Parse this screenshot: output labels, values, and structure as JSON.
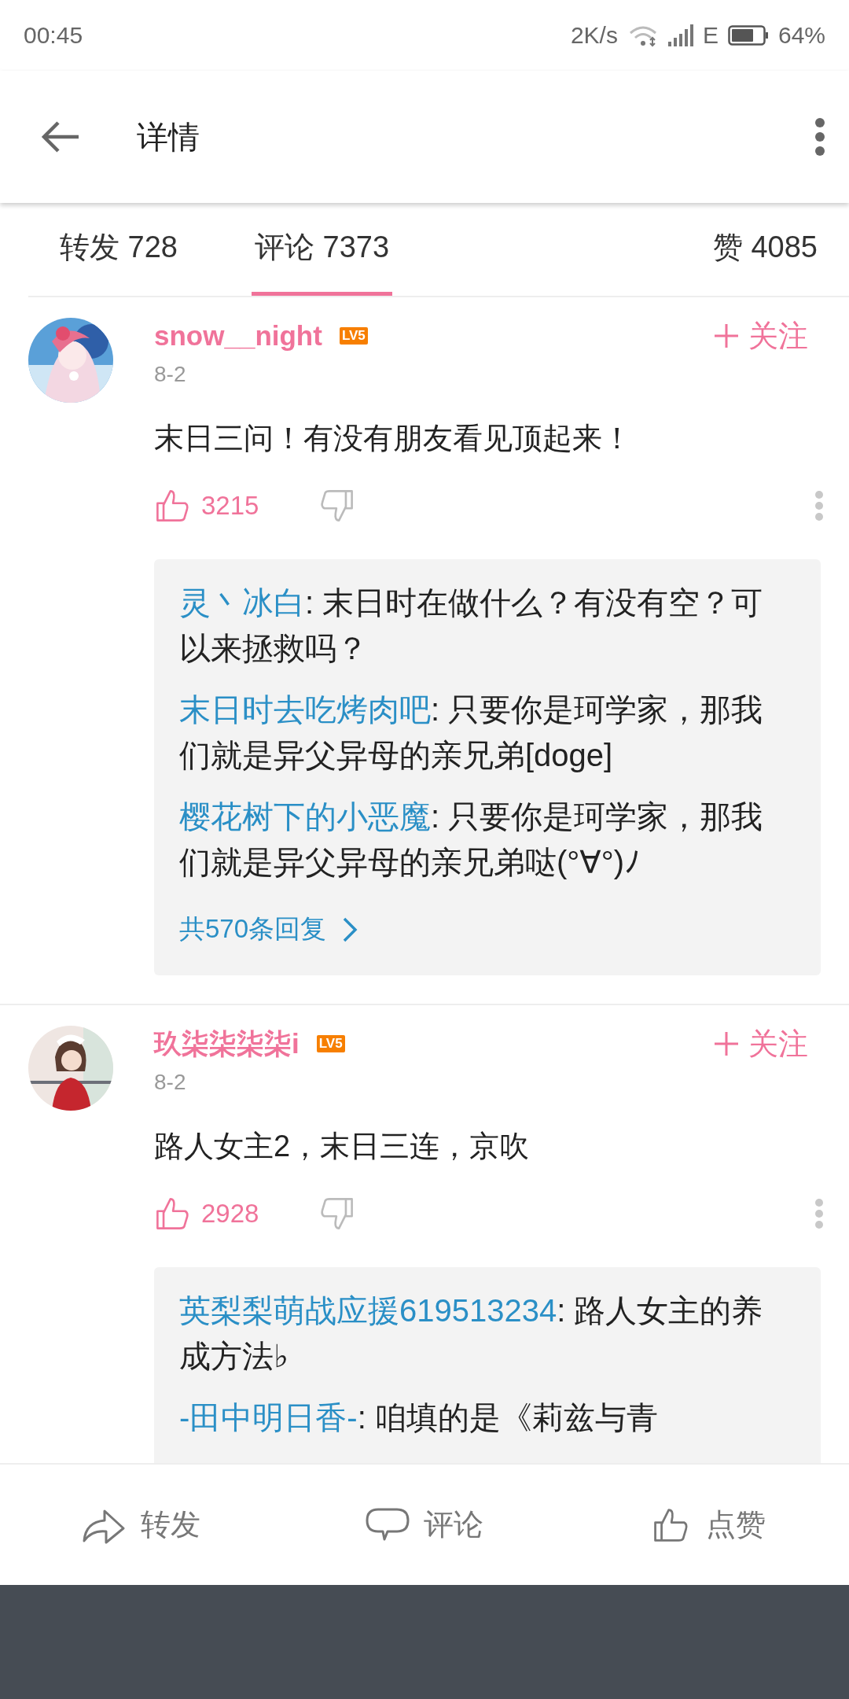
{
  "status_bar": {
    "time": "00:45",
    "speed": "2K/s",
    "network": "E",
    "battery": "64%"
  },
  "toolbar": {
    "title": "详情"
  },
  "tabs": [
    {
      "label": "转发 728",
      "selected": false
    },
    {
      "label": "评论 7373",
      "selected": true
    },
    {
      "label": "赞 4085",
      "selected": false
    }
  ],
  "comments": [
    {
      "user": "snow__night",
      "level": "LV5",
      "follow": "关注",
      "date": "8-2",
      "text": "末日三问！有没有朋友看见顶起来！",
      "likes": "3215",
      "replies": [
        {
          "user": "灵丶冰白",
          "text": ": 末日时在做什么？有没有空？可以来拯救吗？"
        },
        {
          "user": "末日时去吃烤肉吧",
          "text": ": 只要你是珂学家，那我们就是异父异母的亲兄弟[doge]"
        },
        {
          "user": "樱花树下的小恶魔",
          "text": ": 只要你是珂学家，那我们就是异父异母的亲兄弟哒(°∀°)ﾉ"
        }
      ],
      "more": "共570条回复"
    },
    {
      "user": "玖柒柒柒柒i",
      "level": "LV5",
      "follow": "关注",
      "date": "8-2",
      "text": "路人女主2，末日三连，京吹",
      "likes": "2928",
      "replies": [
        {
          "user": "英梨梨萌战应援619513234",
          "text": ": 路人女主的养成方法♭"
        },
        {
          "user": "-田中明日香-",
          "text": ": 咱填的是《莉兹与青"
        }
      ]
    }
  ],
  "bottom_actions": [
    {
      "kind": "share",
      "label": "转发"
    },
    {
      "kind": "comment",
      "label": "评论"
    },
    {
      "kind": "like",
      "label": "点赞"
    }
  ]
}
